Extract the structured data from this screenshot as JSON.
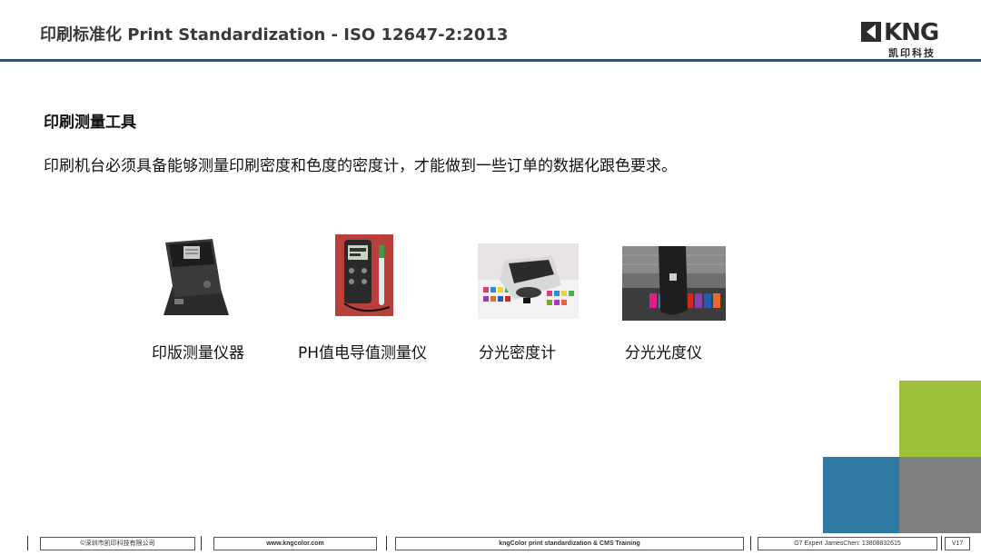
{
  "header": {
    "title": "印刷标准化 Print Standardization - ISO 12647-2:2013",
    "logo_letters": "KNG",
    "logo_cn": "凯印科技"
  },
  "main": {
    "heading": "印刷测量工具",
    "description": "印刷机台必须具备能够测量印刷密度和色度的密度计，才能做到一些订单的数据化跟色要求。",
    "tools": [
      {
        "label": "印版测量仪器",
        "icon": "plate-reader-image"
      },
      {
        "label": "PH值电导值测量仪",
        "icon": "ph-meter-image"
      },
      {
        "label": "分光密度计",
        "icon": "spectrodensitometer-image"
      },
      {
        "label": "分光光度仪",
        "icon": "spectrophotometer-image"
      }
    ]
  },
  "colors": {
    "header_rule": "#1f5a80",
    "green": "#9dc13a",
    "blue": "#2e7aa3",
    "gray": "#7f7f7f"
  },
  "footer": {
    "company": "©深圳市凯印科技有限公司",
    "website": "www.kngcolor.com",
    "training": "kngColor print standardization & CMS Training",
    "contact": "G7 Expert JamesChen: 13808832615",
    "version": "V17"
  }
}
